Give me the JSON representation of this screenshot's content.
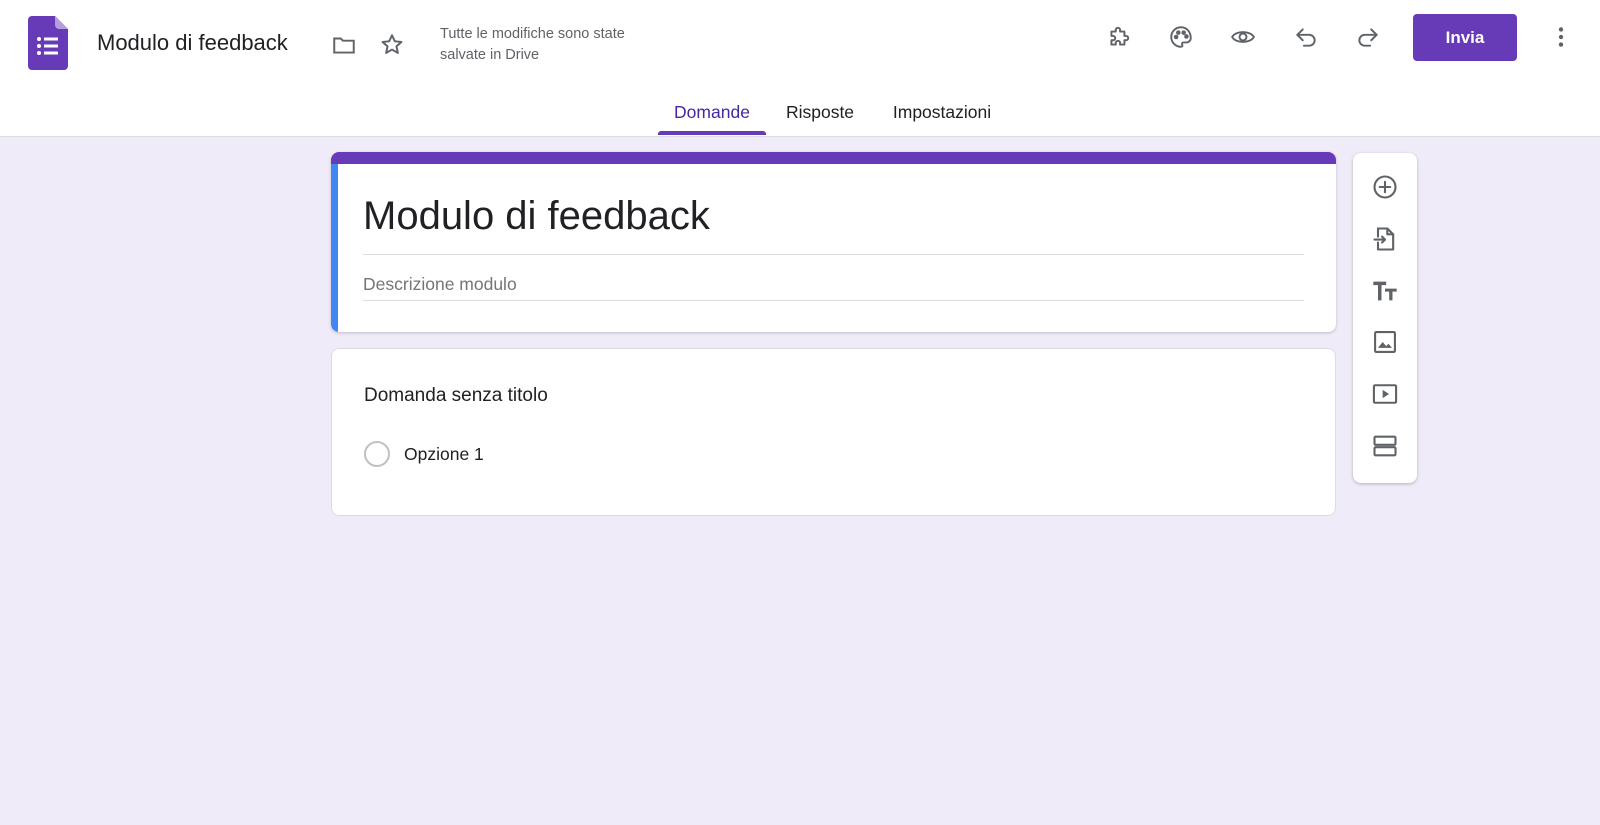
{
  "header": {
    "doc_title": "Modulo di feedback",
    "save_status": "Tutte le modifiche sono state salvate in Drive",
    "send_label": "Invia"
  },
  "tabs": [
    {
      "label": "Domande",
      "active": true
    },
    {
      "label": "Risposte",
      "active": false
    },
    {
      "label": "Impostazioni",
      "active": false
    }
  ],
  "form": {
    "title": "Modulo di feedback",
    "description_placeholder": "Descrizione modulo"
  },
  "question": {
    "title": "Domanda senza titolo",
    "options": [
      {
        "label": "Opzione 1"
      }
    ]
  },
  "icons": {
    "header": [
      "folder-icon",
      "star-icon",
      "addon-icon",
      "palette-icon",
      "preview-icon",
      "undo-icon",
      "redo-icon",
      "more-vert-icon"
    ],
    "toolbar": [
      "add-question-icon",
      "import-questions-icon",
      "add-title-icon",
      "add-image-icon",
      "add-video-icon",
      "add-section-icon"
    ]
  },
  "colors": {
    "accent": "#673ab7",
    "tab_active": "#4527a0",
    "left_band": "#4285f4",
    "background": "#f0ebf8"
  }
}
